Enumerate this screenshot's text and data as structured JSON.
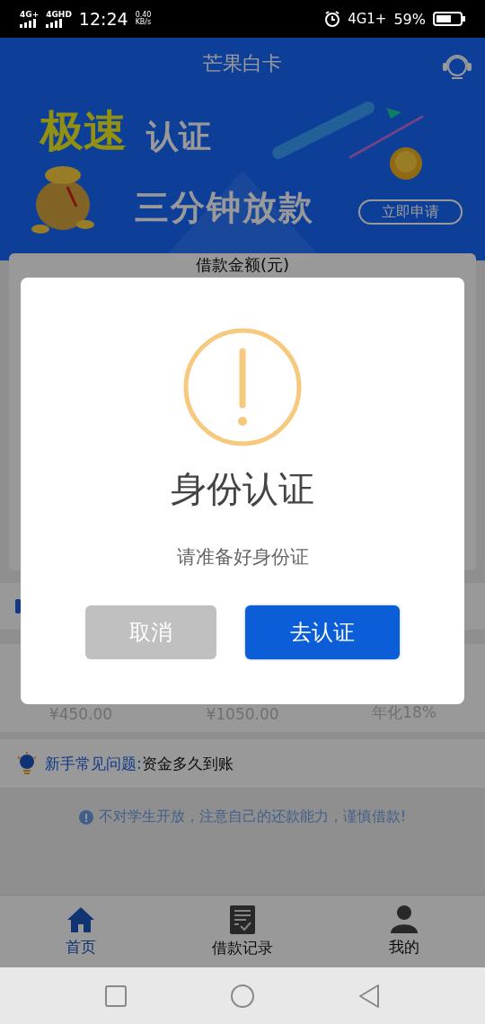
{
  "status_bar": {
    "signals": [
      "4G+",
      "4GHD"
    ],
    "time": "12:24",
    "speed": "0.40",
    "speed_unit": "KB/s",
    "network": "4G1+",
    "battery": "59%"
  },
  "header": {
    "title": "芒果白卡"
  },
  "banner": {
    "headline_accent": "极速",
    "headline": "认证",
    "subline": "三分钟放款",
    "action": "立即申请"
  },
  "loan_card": {
    "title": "借款金额(元)"
  },
  "stats": [
    {
      "value": "¥450.00"
    },
    {
      "value": "¥1050.00"
    },
    {
      "value": "年化18%"
    }
  ],
  "faq": {
    "label": "新手常见问题:",
    "question": "资金多久到账"
  },
  "notice": "不对学生开放，注意自己的还款能力，谨慎借款!",
  "tabs": [
    {
      "label": "首页",
      "kind": "home",
      "selected": true
    },
    {
      "label": "借款记录",
      "kind": "records",
      "selected": false
    },
    {
      "label": "我的",
      "kind": "profile",
      "selected": false
    }
  ],
  "dialog": {
    "title": "身份认证",
    "message": "请准备好身份证",
    "buttons": [
      {
        "label": "取消",
        "kind": "cancel"
      },
      {
        "label": "去认证",
        "kind": "confirm"
      }
    ]
  }
}
